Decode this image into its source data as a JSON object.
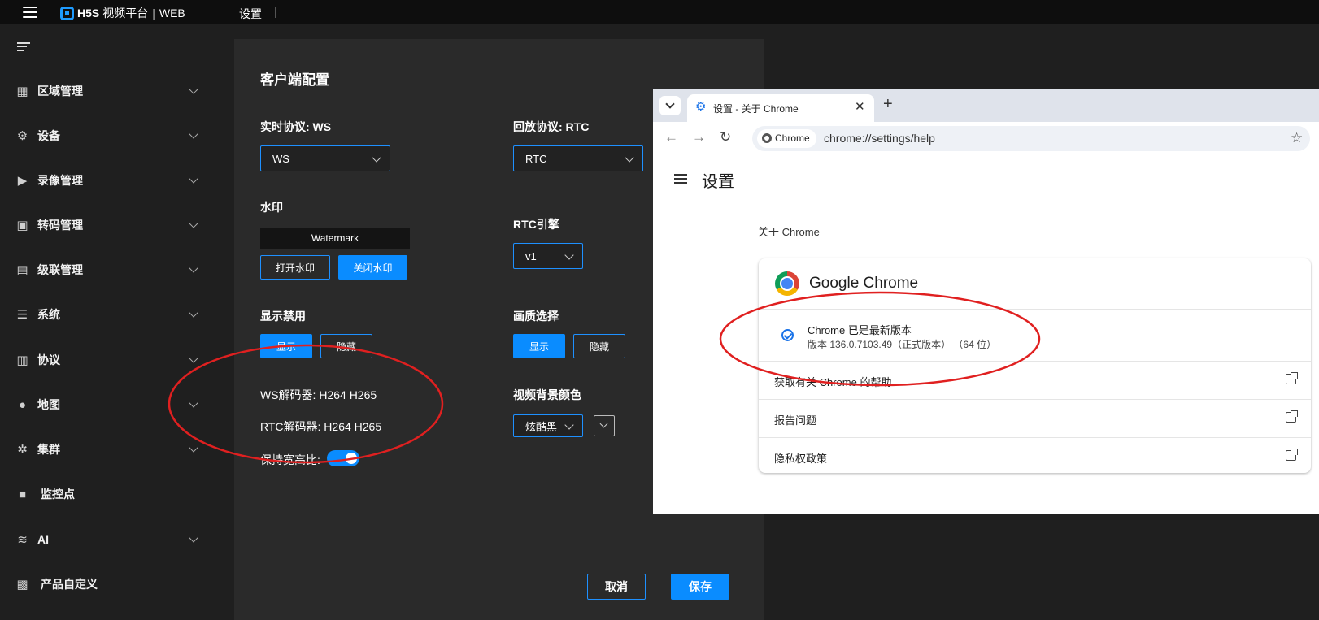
{
  "topbar": {
    "brand_bold": "H5S",
    "brand_name": "视频平台",
    "brand_sep": "|",
    "brand_suffix": "WEB",
    "page_title": "设置"
  },
  "sidebar": {
    "items": [
      {
        "label": "区域管理",
        "icon": "building-icon"
      },
      {
        "label": "设备",
        "icon": "gear-icon"
      },
      {
        "label": "录像管理",
        "icon": "play-icon"
      },
      {
        "label": "转码管理",
        "icon": "transcode-icon"
      },
      {
        "label": "级联管理",
        "icon": "cascade-icon"
      },
      {
        "label": "系统",
        "icon": "sliders-icon"
      },
      {
        "label": "协议",
        "icon": "document-icon"
      },
      {
        "label": "地图",
        "icon": "user-pin-icon"
      },
      {
        "label": "集群",
        "icon": "cluster-icon"
      },
      {
        "label": "监控点",
        "icon": "camera-icon"
      },
      {
        "label": "AI",
        "icon": "waveform-icon"
      },
      {
        "label": "产品自定义",
        "icon": "custom-icon"
      }
    ]
  },
  "panel": {
    "title": "客户端配置",
    "realtime_protocol": {
      "label": "实时协议: WS",
      "value": "WS"
    },
    "playback_protocol": {
      "label": "回放协议: RTC",
      "value": "RTC"
    },
    "watermark": {
      "label": "水印",
      "text": "Watermark",
      "open_label": "打开水印",
      "close_label": "关闭水印"
    },
    "rtc_engine": {
      "label": "RTC引擎",
      "value": "v1"
    },
    "display_disable": {
      "label": "显示禁用",
      "show_label": "显示",
      "hide_label": "隐藏"
    },
    "quality": {
      "label": "画质选择",
      "show_label": "显示",
      "hide_label": "隐藏"
    },
    "ws_decoder": "WS解码器:  H264 H265",
    "rtc_decoder": "RTC解码器:  H264 H265",
    "keep_ratio": {
      "label": "保持宽高比:",
      "enabled": true
    },
    "bg_color": {
      "label": "视频背景颜色",
      "value": "炫酷黑"
    },
    "cancel_label": "取消",
    "save_label": "保存"
  },
  "chrome": {
    "tab_title": "设置 - 关于 Chrome",
    "new_tab": "+",
    "close": "✕",
    "site_chip": "Chrome",
    "url": "chrome://settings/help",
    "settings_title": "设置",
    "about_label": "关于 Chrome",
    "product_name": "Google Chrome",
    "status": "Chrome 已是最新版本",
    "version": "版本 136.0.7103.49（正式版本）  （64 位）",
    "links": [
      "获取有关 Chrome 的帮助",
      "报告问题",
      "隐私权政策"
    ]
  },
  "colors": {
    "accent": "#0a8cff",
    "annotation": "#e02020",
    "background": "#1f1f1f",
    "panel": "#2a2a2a"
  }
}
